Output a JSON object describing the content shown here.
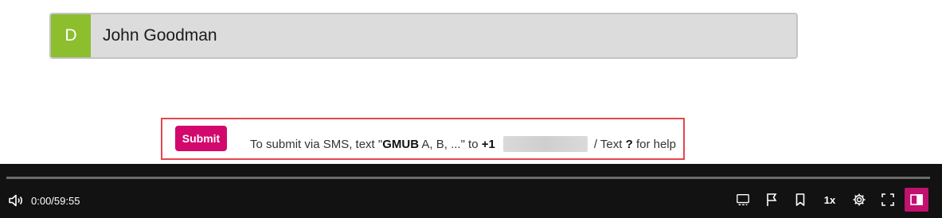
{
  "option": {
    "letter": "D",
    "text": "John Goodman"
  },
  "submit": {
    "button_label": "Submit",
    "sms_prefix": "To submit via SMS, text \"",
    "sms_code": "GMUB",
    "sms_middle": " A, B, ...\" to ",
    "sms_phone_prefix": "+1",
    "sms_suffix_1": "/ Text ",
    "sms_question": "?",
    "sms_suffix_2": " for help"
  },
  "player": {
    "time": "0:00/59:55",
    "speed": "1x",
    "progress": 0
  },
  "colors": {
    "accent": "#d2086d",
    "option_letter_bg": "#8cbe2e",
    "highlight_border": "#e4474d",
    "player_bg": "#121212"
  },
  "icons": [
    "volume-icon",
    "captions-icon",
    "flag-icon",
    "bookmark-icon",
    "settings-icon",
    "fullscreen-icon",
    "side-panel-icon"
  ]
}
